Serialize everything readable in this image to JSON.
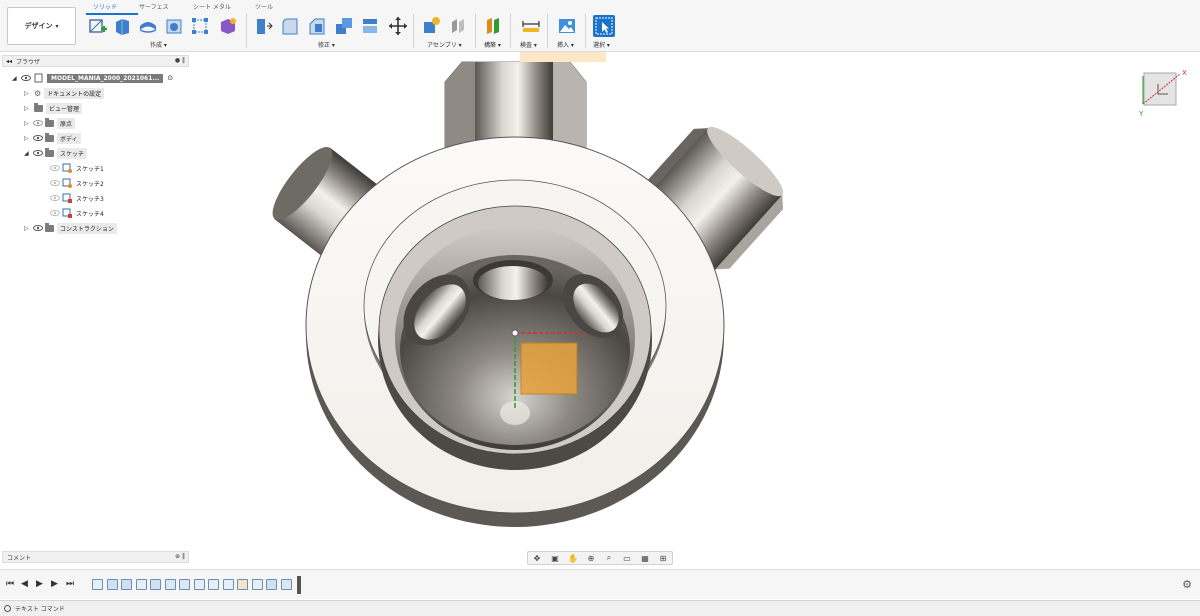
{
  "toolbar": {
    "design_label": "デザイン",
    "tabs": [
      "ソリッド",
      "サーフェス",
      "シート メタル",
      "ツール"
    ],
    "groups": [
      "作成",
      "修正",
      "アセンブリ",
      "構築",
      "検査",
      "挿入",
      "選択"
    ],
    "accent_color": "#1a73c8"
  },
  "browser": {
    "title": "ブラウザ",
    "root": "MODEL_MANIA_2000_2021061...",
    "items": [
      "ドキュメントの設定",
      "ビュー管理",
      "原点",
      "ボディ",
      "スケッチ"
    ],
    "sketches": [
      "スケッチ1",
      "スケッチ2",
      "スケッチ3",
      "スケッチ4"
    ],
    "construction": "コンストラクション"
  },
  "viewcube": {
    "x_label": "X",
    "y_label": "Y"
  },
  "comment": {
    "label": "コメント"
  },
  "timeline": {
    "features": [
      "sketch",
      "extrude",
      "revolve",
      "sketch",
      "extrude",
      "shell",
      "shell",
      "pattern",
      "sketch",
      "sketch",
      "combine",
      "sketch",
      "extrude",
      "shell"
    ]
  },
  "textcommand": {
    "label": "テキスト コマンド"
  }
}
